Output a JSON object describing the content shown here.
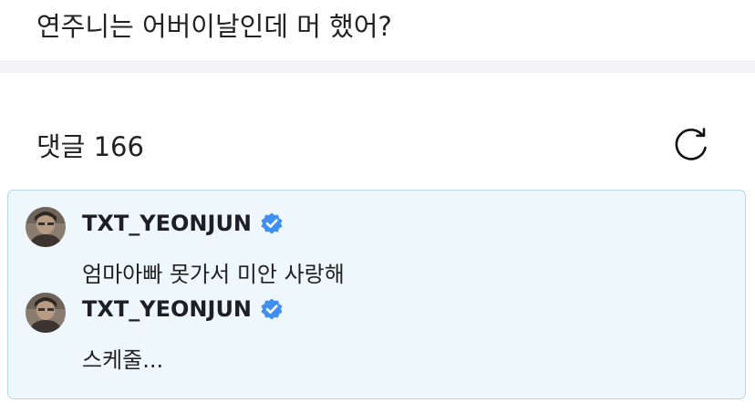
{
  "post": {
    "text": "연주니는 어버이날인데 머 했어?"
  },
  "comments_header": {
    "label": "댓글 166",
    "refresh_icon": "refresh-icon"
  },
  "comments": [
    {
      "author": "TXT_YEONJUN",
      "verified": true,
      "text": "엄마아빠 못가서 미안 사랑해"
    },
    {
      "author": "TXT_YEONJUN",
      "verified": true,
      "text": "스케줄..."
    }
  ],
  "colors": {
    "highlight_background": "#eef7fc",
    "highlight_border": "#b7d8ea",
    "verified_badge": "#3f8ef0"
  }
}
